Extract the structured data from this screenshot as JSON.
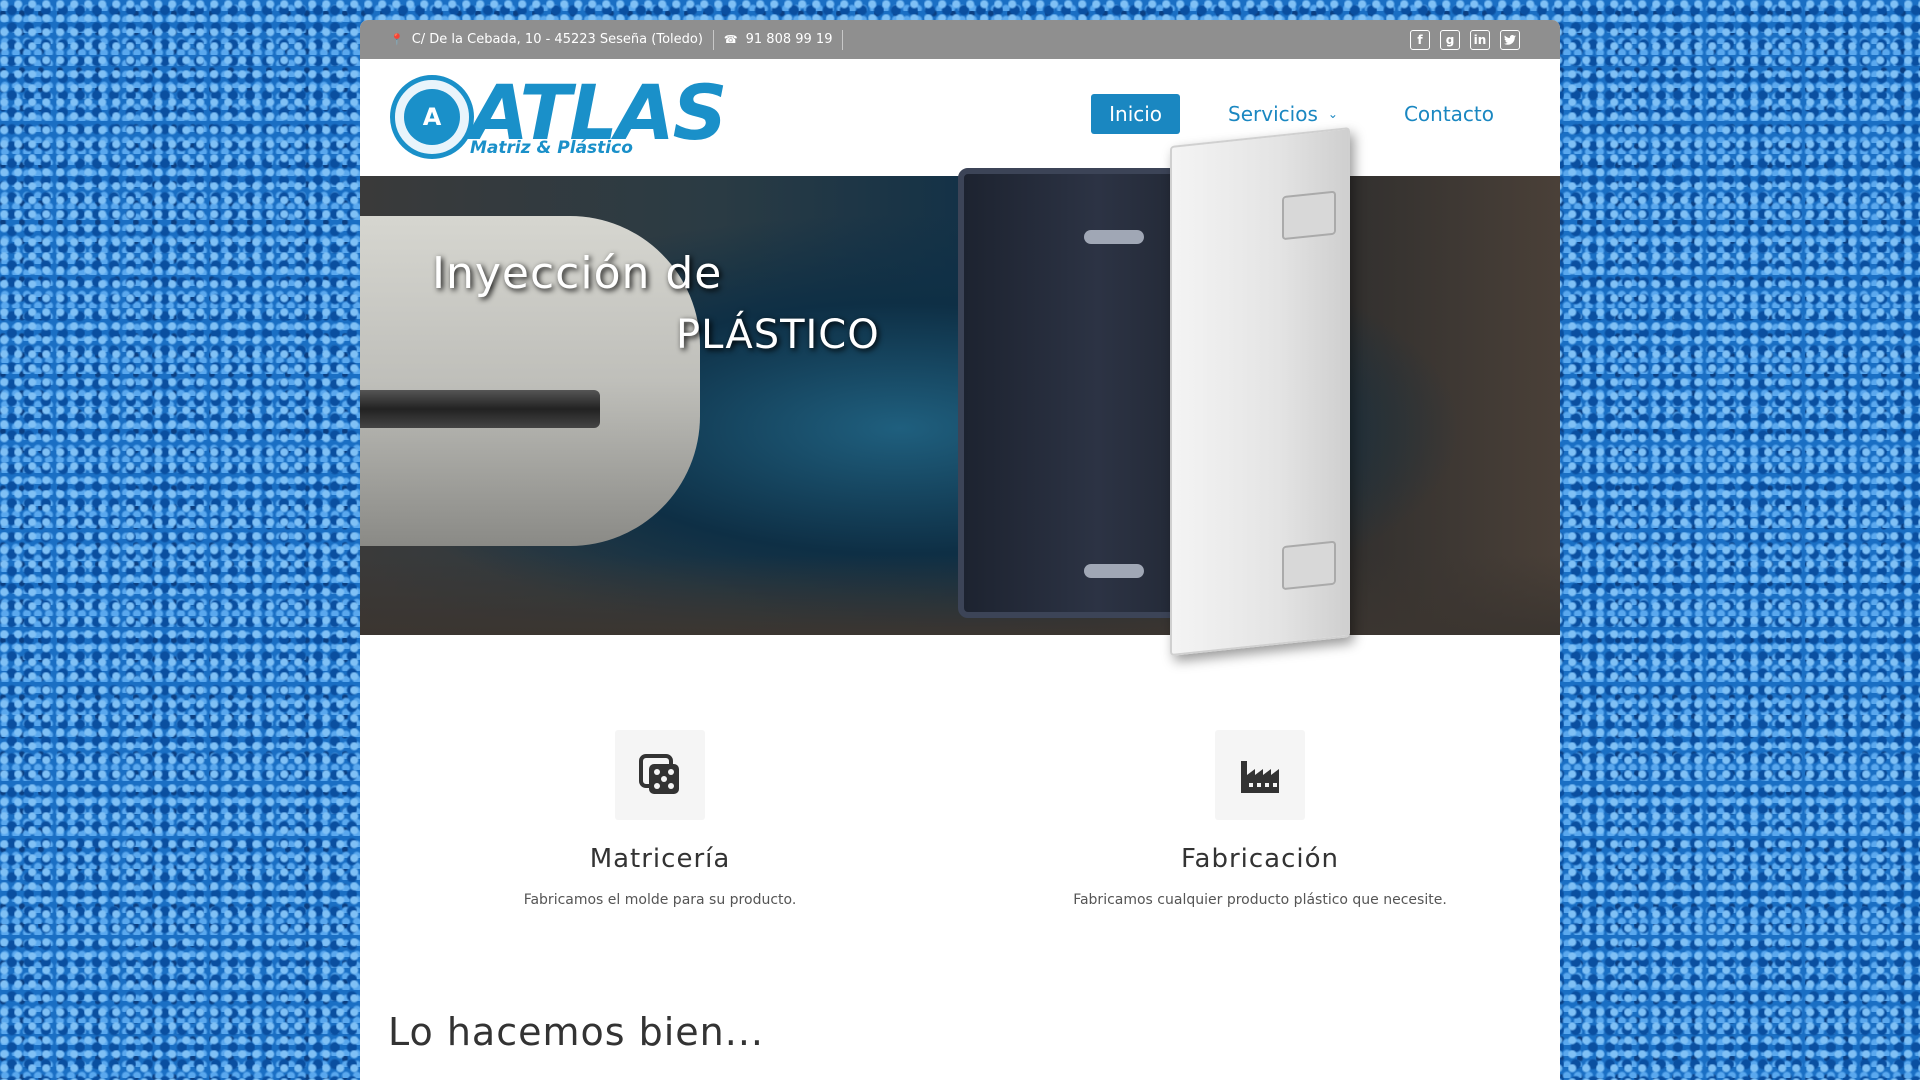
{
  "topbar": {
    "address": "C/ De la Cebada, 10 - 45223 Seseña (Toledo)",
    "phone": "91 808 99 19",
    "socials": [
      "facebook-icon",
      "google-plus-icon",
      "linkedin-icon",
      "twitter-icon"
    ]
  },
  "logo": {
    "title": "ATLAS",
    "subtitle": "Matriz & Plástico"
  },
  "nav": {
    "items": [
      {
        "label": "Inicio",
        "active": true
      },
      {
        "label": "Servicios",
        "dropdown": true
      },
      {
        "label": "Contacto"
      }
    ]
  },
  "hero": {
    "line1": "Inyección de",
    "line2": "PLÁSTICO"
  },
  "services": [
    {
      "icon": "molds-icon",
      "title": "Matricería",
      "text": "Fabricamos el molde para su producto."
    },
    {
      "icon": "factory-icon",
      "title": "Fabricación",
      "text": "Fabricamos cualquier producto plástico que necesite."
    }
  ],
  "section": {
    "title": "Lo hacemos bien..."
  },
  "colors": {
    "accent": "#1a87c1",
    "topbar": "#8f8f8f",
    "background": "#1a6fc4"
  }
}
